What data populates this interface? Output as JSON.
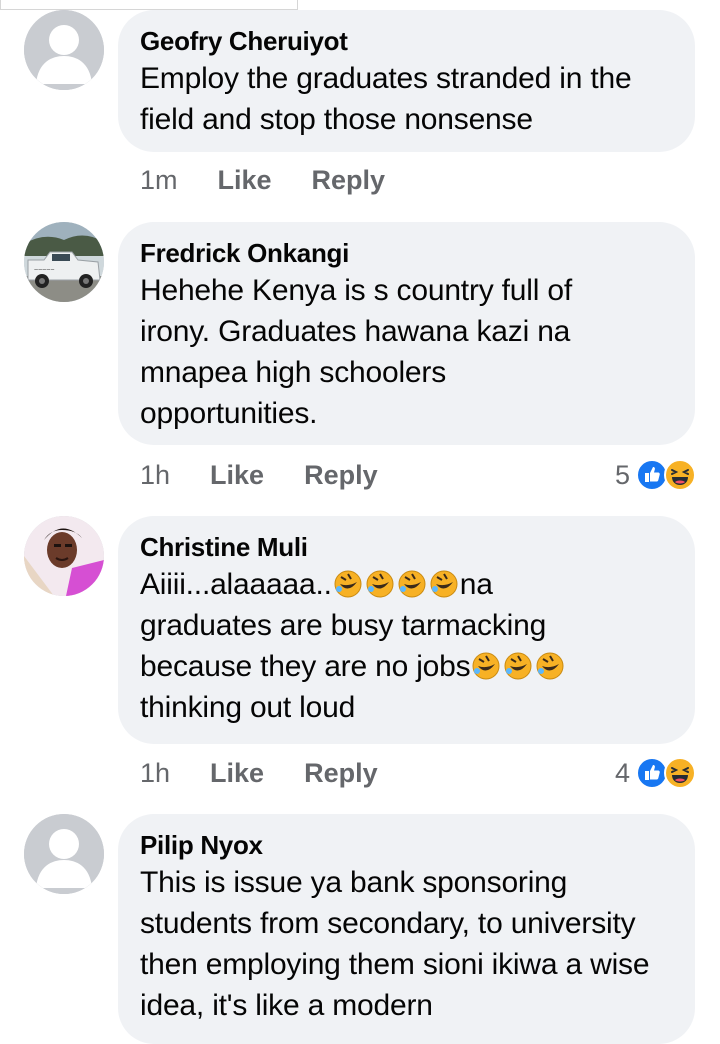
{
  "comments": [
    {
      "author": "Geofry Cheruiyot",
      "text": "Employ the graduates stranded in the field and stop those nonsense",
      "time": "1m",
      "like_label": "Like",
      "reply_label": "Reply"
    },
    {
      "author": "Fredrick Onkangi",
      "text": "Hehehe Kenya is s country full of irony. Graduates hawana kazi na mnapea high schoolers opportunities.",
      "time": "1h",
      "like_label": "Like",
      "reply_label": "Reply",
      "reaction_count": "5",
      "reaction_icons": [
        "like-icon",
        "haha-icon"
      ]
    },
    {
      "author": "Christine Muli",
      "text_part1": "Aiiii...alaaaaa..",
      "text_emoji1": "🤣🤣🤣🤣",
      "text_part2": "na\ngraduates are busy tarmacking\nbecause they are no jobs",
      "text_emoji2": "🤣🤣🤣",
      "text_part3": "\nthinking out loud",
      "time": "1h",
      "like_label": "Like",
      "reply_label": "Reply",
      "reaction_count": "4",
      "reaction_icons": [
        "like-icon",
        "haha-icon"
      ]
    },
    {
      "author": "Pilip Nyox",
      "text": "This is issue ya bank sponsoring students from secondary, to university then employing them sioni ikiwa a wise idea, it's like a modern",
      "avatar_icon": "default-profile-icon"
    }
  ],
  "colors": {
    "bubble": "#f0f2f5",
    "secondary_text": "#65676b",
    "like_blue": "#1877f2",
    "haha_yellow": "#f7b125"
  }
}
